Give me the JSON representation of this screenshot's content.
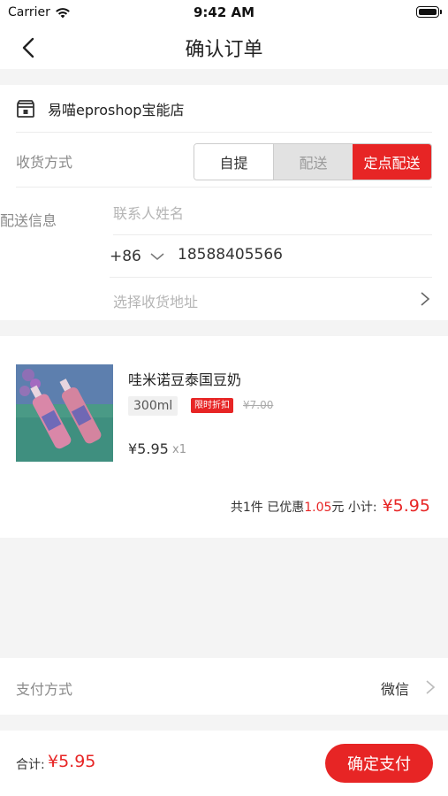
{
  "status_bar": {
    "carrier": "Carrier",
    "time": "9:42 AM"
  },
  "nav": {
    "title": "确认订单"
  },
  "store": {
    "name": "易喵eproshop宝能店"
  },
  "receive": {
    "label": "收货方式",
    "options": [
      "自提",
      "配送",
      "定点配送"
    ],
    "selected": "定点配送"
  },
  "shipping": {
    "label": "配送信息",
    "name_placeholder": "联系人姓名",
    "country_code": "+86",
    "phone": "18588405566",
    "address_placeholder": "选择收货地址"
  },
  "product": {
    "name": "哇米诺豆泰国豆奶",
    "spec": "300ml",
    "tag": "限时折扣",
    "original_price": "¥7.00",
    "price": "¥5.95",
    "quantity": "x1"
  },
  "summary": {
    "count_text": "共1件 已优惠",
    "discount": "1.05",
    "discount_unit": "元 小计:",
    "subtotal": "¥5.95"
  },
  "payment": {
    "label": "支付方式",
    "method": "微信"
  },
  "footer": {
    "total_label": "合计:",
    "total_value": "¥5.95",
    "pay_button": "确定支付"
  },
  "colors": {
    "accent": "#e72525",
    "background": "#f4f4f4"
  }
}
